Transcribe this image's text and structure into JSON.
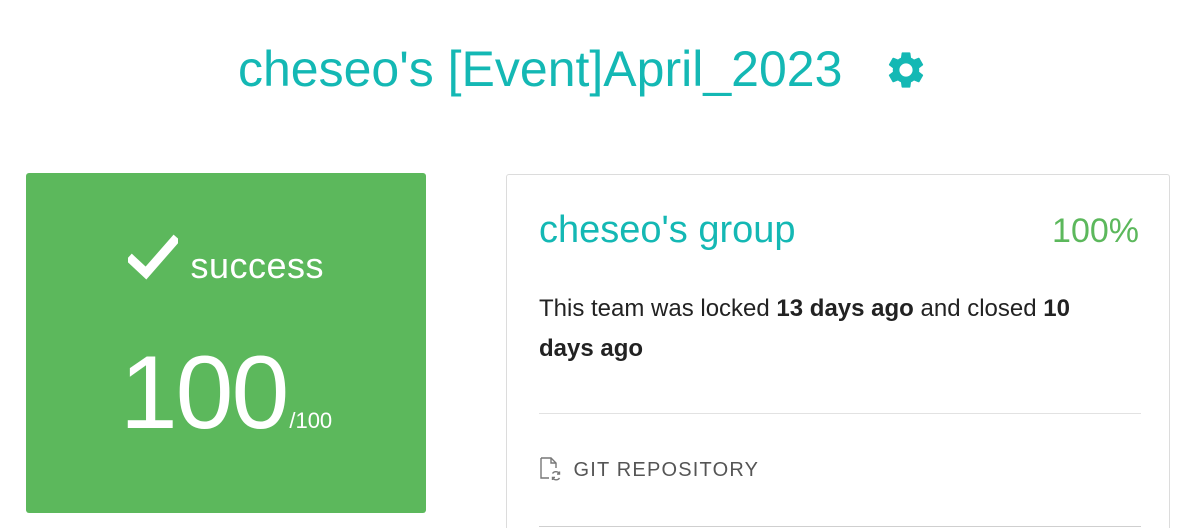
{
  "header": {
    "title": "cheseo's [Event]April_2023",
    "settings_icon": "gear-icon",
    "accent_color": "#14b8b4"
  },
  "score_card": {
    "status_icon": "check-icon",
    "status_label": "success",
    "score": "100",
    "max_score": "/100",
    "background_color": "#5cb85c"
  },
  "team_card": {
    "group_name": "cheseo's group",
    "percent": "100%",
    "percent_color": "#5cb85c",
    "lock_text_1": "This team was locked ",
    "locked_ago": "13 days ago",
    "lock_text_2": " and closed ",
    "closed_ago": "10 days ago",
    "repository_icon": "git-repository-icon",
    "repository_label": "GIT REPOSITORY"
  }
}
